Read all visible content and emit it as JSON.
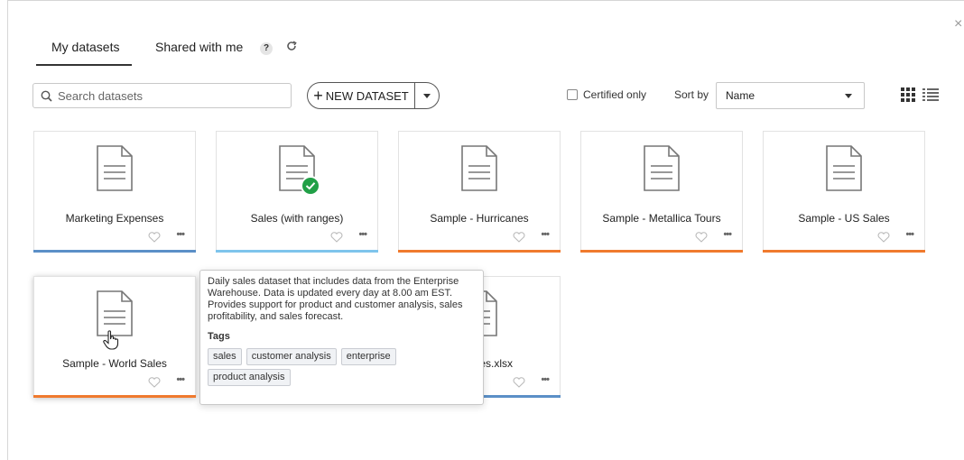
{
  "tabs": [
    {
      "label": "My datasets"
    },
    {
      "label": "Shared with me"
    }
  ],
  "help_label": "?",
  "search": {
    "placeholder": "Search datasets"
  },
  "new_dataset": {
    "plus": "+",
    "label": "NEW DATASET"
  },
  "certified_label": "Certified only",
  "sort": {
    "label": "Sort by",
    "value": "Name"
  },
  "colors": {
    "blue": "#5b8fc7",
    "light_blue": "#7ec4ec",
    "orange": "#f07a2e",
    "certified_green": "#21a047"
  },
  "cards": [
    {
      "title": "Marketing Expenses",
      "bar_color": "#5b8fc7"
    },
    {
      "title": "Sales (with ranges)",
      "bar_color": "#7ec4ec",
      "certified": true
    },
    {
      "title": "Sample - Hurricanes",
      "bar_color": "#f07a2e"
    },
    {
      "title": "Sample - Metallica Tours",
      "bar_color": "#f07a2e"
    },
    {
      "title": "Sample - US Sales",
      "bar_color": "#f07a2e"
    },
    {
      "title": "Sample - World Sales",
      "bar_color": "#f07a2e"
    },
    {
      "title": "rnames.xlsx",
      "bar_color": "#5b8fc7"
    }
  ],
  "more_label": "•••",
  "tooltip": {
    "description": "Daily sales dataset that includes data from the Enterprise Warehouse. Data is updated every day at 8.00 am EST. Provides support for product and customer analysis, sales profitability, and sales forecast.",
    "tags_label": "Tags",
    "tags": [
      "sales",
      "customer analysis",
      "enterprise",
      "product analysis"
    ]
  },
  "close_label": "×"
}
